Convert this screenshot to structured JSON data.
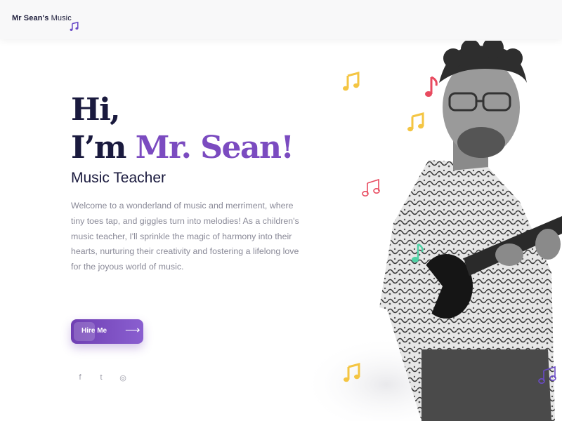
{
  "header": {
    "logo_bold": "Mr Sean's",
    "logo_light": "Music"
  },
  "hero": {
    "line1": "Hi,",
    "line2_prefix": "I’m ",
    "line2_name": "Mr. Sean!",
    "role": "Music Teacher",
    "intro": "Welcome to a wonderland of music and merriment, where tiny toes tap, and giggles turn into melodies! As a children's music teacher, I'll sprinkle the magic of harmony into their hearts, nurturing their creativity and fostering a lifelong love for the joyous world of music.",
    "cta_label": "Hire Me",
    "cta_arrow": "⟶"
  },
  "social": {
    "facebook_glyph": "f",
    "twitter_glyph": "t",
    "instagram_glyph": "◎"
  },
  "colors": {
    "accent": "#7b4bc0",
    "heading": "#1a1a3e",
    "note_yellow": "#f4c542",
    "note_red": "#e84a5f",
    "note_teal": "#4fd1a5",
    "note_purple": "#6a4bc7"
  }
}
